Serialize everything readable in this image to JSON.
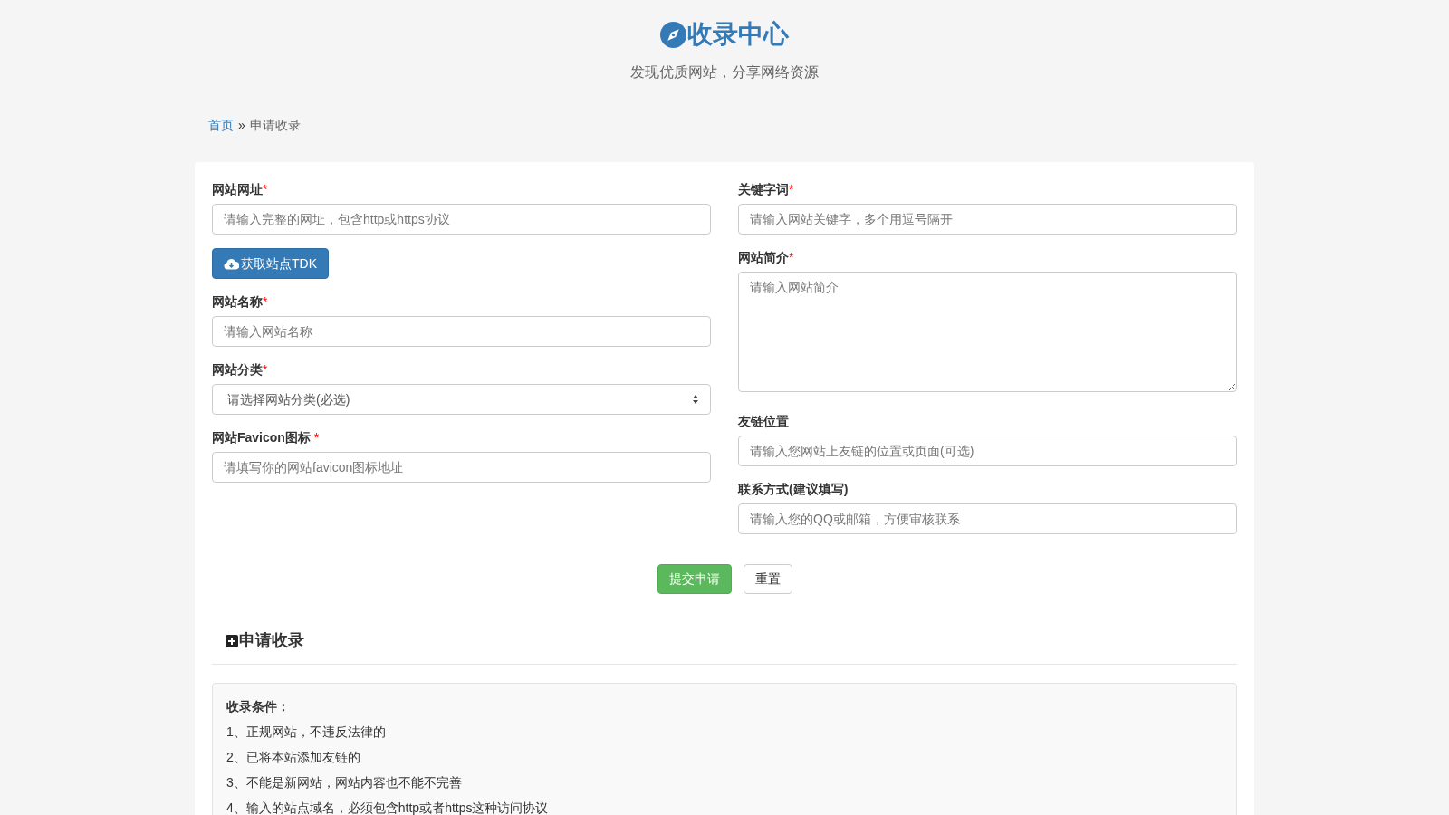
{
  "header": {
    "title": "收录中心",
    "subtitle": "发现优质网站，分享网络资源"
  },
  "breadcrumb": [
    {
      "label": "首页",
      "kind": "link"
    },
    {
      "label": "»",
      "kind": "separator"
    },
    {
      "label": "申请收录",
      "kind": "current"
    }
  ],
  "form": {
    "left": [
      {
        "kind": "text",
        "label": "网站网址",
        "mark": "*",
        "placeholder": "请输入完整的网址，包含http或https协议"
      },
      {
        "kind": "button",
        "label": "获取站点TDK"
      },
      {
        "kind": "text",
        "label": "网站名称",
        "mark": "*",
        "placeholder": "请输入网站名称"
      },
      {
        "kind": "select",
        "label": "网站分类",
        "mark": "*",
        "value": "请选择网站分类(必选)"
      },
      {
        "kind": "text",
        "label": "网站Favicon图标 ",
        "mark": "*",
        "placeholder": "请填写你的网站favicon图标地址"
      }
    ],
    "right": [
      {
        "kind": "text",
        "label": "关键字词",
        "mark": "*",
        "placeholder": "请输入网站关键字，多个用逗号隔开"
      },
      {
        "kind": "textarea",
        "label": "网站简介",
        "mark": "*",
        "placeholder": "请输入网站简介"
      },
      {
        "kind": "text",
        "label": "友链位置",
        "placeholder": "请输入您网站上友链的位置或页面(可选)"
      },
      {
        "kind": "text",
        "label": "联系方式(建议填写)",
        "placeholder": "请输入您的QQ或邮箱，方便审核联系"
      }
    ],
    "buttons": [
      {
        "label": "提交申请",
        "kind": "primary"
      },
      {
        "label": "重置",
        "kind": "default"
      }
    ]
  },
  "section": {
    "title": "申请收录",
    "notice_title": "收录条件：",
    "items": [
      "1、正规网站，不违反法律的",
      "2、已将本站添加友链的",
      "3、不能是新网站，网站内容也不能不完善",
      "4、输入的站点域名，必须包含http或者https这种访问协议"
    ]
  }
}
